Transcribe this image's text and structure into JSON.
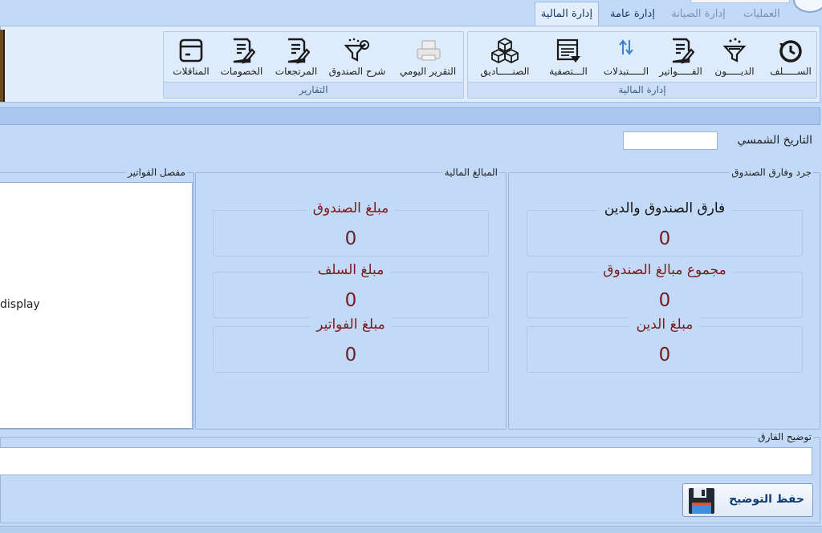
{
  "tabs": [
    {
      "label": "إدارة المالية",
      "active": true
    },
    {
      "label": "إدارة عامة",
      "active": false
    },
    {
      "label": "إدارة الصيانة",
      "active": false
    },
    {
      "label": "العمليات",
      "active": false
    }
  ],
  "ribbon": {
    "finance_group": {
      "label": "إدارة المالية",
      "buttons": [
        {
          "label": "الســـــلف",
          "icon": "clock-back-icon"
        },
        {
          "label": "الديـــــون",
          "icon": "funnel-icon"
        },
        {
          "label": "الفـــــواتير",
          "icon": "document-edit-icon"
        },
        {
          "label": "الـــــتبدلات",
          "icon": "swap-arrows-icon"
        },
        {
          "label": "الـــتصفية",
          "icon": "table-settings-icon"
        },
        {
          "label": "الصنـــــاديق",
          "icon": "boxes-icon"
        }
      ]
    },
    "reports_group": {
      "label": "التقارير",
      "buttons": [
        {
          "label": "التقرير اليومي",
          "icon": "printer-icon"
        },
        {
          "label": "شرح الصندوق",
          "icon": "filter-settings-icon"
        },
        {
          "label": "المرتجعات",
          "icon": "document-edit-icon"
        },
        {
          "label": "الخصومات",
          "icon": "document-edit-icon"
        },
        {
          "label": "المناقلات",
          "icon": "archive-box-icon"
        }
      ]
    }
  },
  "date_field": {
    "label": "التاريخ الشمسي",
    "value": ""
  },
  "reconciliation": {
    "title": "جرد وفارق الصندوق",
    "items": [
      {
        "label": "فارق الصندوق والدين",
        "value": "0"
      },
      {
        "label": "مجموع مبالغ الصندوق",
        "value": "0"
      },
      {
        "label": "مبلغ الدين",
        "value": "0"
      }
    ]
  },
  "amounts": {
    "title": "المبالغ المالية",
    "items": [
      {
        "label": "مبلغ الصندوق",
        "value": "0"
      },
      {
        "label": "مبلغ السلف",
        "value": "0"
      },
      {
        "label": "مبلغ الفواتير",
        "value": "0"
      }
    ]
  },
  "invoices": {
    "title": "مفصل الفواتير",
    "display_text": "display"
  },
  "explanation": {
    "label": "توضيح الفارق",
    "value": "",
    "save_label": "حفظ التوضيح"
  },
  "colors": {
    "accent": "#7a1a1a",
    "background": "#c2daf7",
    "ribbon": "#e3eefc"
  }
}
